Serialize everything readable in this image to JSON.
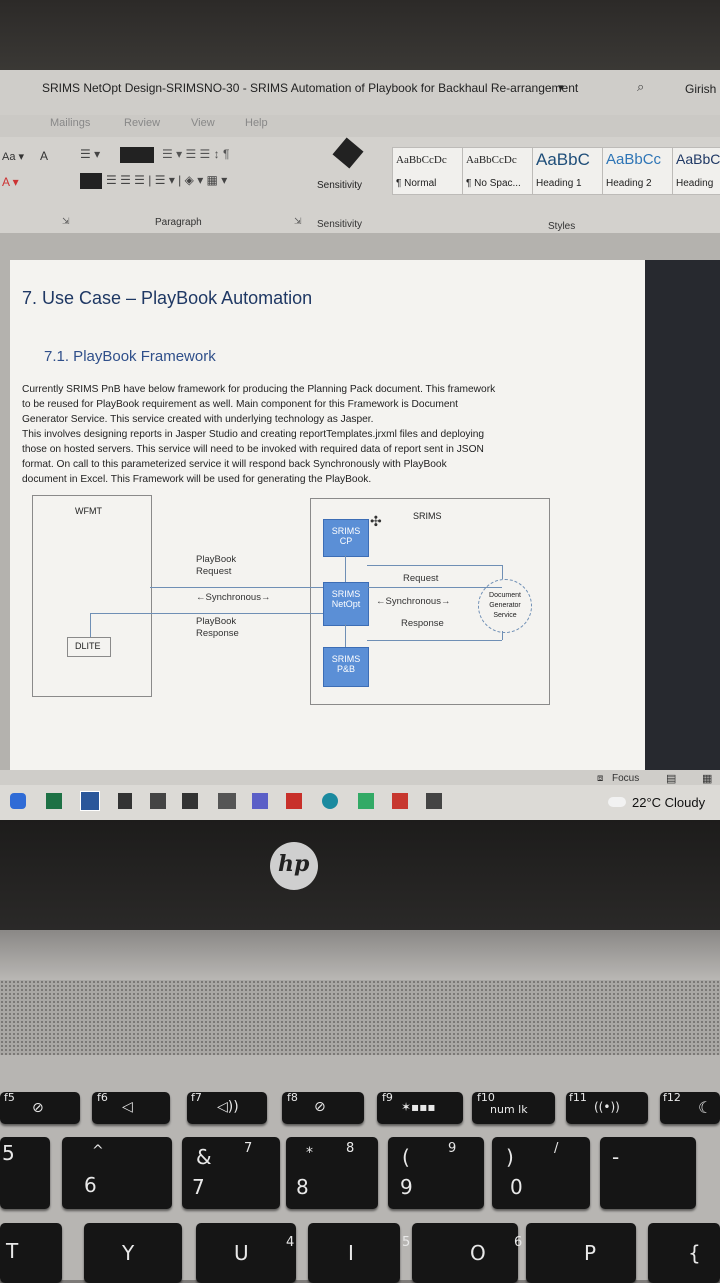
{
  "window": {
    "title": "SRIMS NetOpt Design-SRIMSNO-30 - SRIMS Automation of Playbook for Backhaul Re-arrangement",
    "title_dropdown": "▾",
    "user": "Girish S"
  },
  "menu": [
    "Mailings",
    "Review",
    "View",
    "Help"
  ],
  "ribbon": {
    "paragraph_label": "Paragraph",
    "sensitivity_button": "Sensitivity",
    "sensitivity_label": "Sensitivity",
    "styles_label": "Styles",
    "styles": [
      {
        "sample": "AaBbCcDc",
        "name": "¶ Normal"
      },
      {
        "sample": "AaBbCcDc",
        "name": "¶ No Spac..."
      },
      {
        "sample": "AaBbC",
        "name": "Heading 1"
      },
      {
        "sample": "AaBbCc",
        "name": "Heading 2"
      },
      {
        "sample": "AaBbC",
        "name": "Heading"
      }
    ]
  },
  "document": {
    "heading1": "7. Use Case – PlayBook Automation",
    "heading2": "7.1.  PlayBook Framework",
    "body_lines": [
      "Currently SRIMS PnB have below framework for producing the Planning Pack document. This framework",
      "to be reused for PlayBook requirement as well. Main component for this Framework is Document",
      "Generator Service. This service created with underlying technology as Jasper.",
      "This involves designing reports in Jasper Studio and creating reportTemplates.jrxml files and deploying",
      "those on hosted servers. This service will need to be invoked with required data of report sent in JSON",
      "format. On call to this parameterized service it will respond back Synchronously with PlayBook",
      "document in Excel. This Framework will be used for generating the PlayBook."
    ],
    "diagram": {
      "wfmt": "WFMT",
      "srims": "SRIMS",
      "dlite": "DLITE",
      "cp_line1": "SRIMS",
      "cp_line2": "CP",
      "netopt_line1": "SRIMS",
      "netopt_line2": "NetOpt",
      "pb_line1": "SRIMS",
      "pb_line2": "P&B",
      "playbook_request_1": "PlayBook",
      "playbook_request_2": "Request",
      "synchronous_left": "←Synchronous→",
      "playbook_response_1": "PlayBook",
      "playbook_response_2": "Response",
      "request": "Request",
      "synchronous_right": "←Synchronous→",
      "response": "Response",
      "docgen_1": "Document",
      "docgen_2": "Generator",
      "docgen_3": "Service"
    }
  },
  "status": {
    "focus": "Focus"
  },
  "taskbar": {
    "weather": "22°C  Cloudy"
  },
  "brand": "hp",
  "keys": {
    "f5": "f5",
    "f6": "f6",
    "f7": "f7",
    "f8": "f8",
    "f9": "f9",
    "f10": "f10",
    "f11": "f11",
    "f12": "f12",
    "numlk": "num lk",
    "amp": "&",
    "seven": "7",
    "star": "*",
    "eight": "8",
    "lparen": "(",
    "nine": "9",
    "rparen": ")",
    "zero": "0",
    "six_top": "^",
    "six": "6",
    "k7": "7",
    "k8": "8",
    "k9": "9",
    "slash": "/",
    "minus": "-",
    "T": "T",
    "Y": "Y",
    "U": "U",
    "four": "4",
    "I": "I",
    "five": "5",
    "O": "O",
    "six_b": "6",
    "P": "P",
    "five_left": "5"
  },
  "colors": {
    "diagram_box": "#5b8fd6",
    "heading_blue": "#1f3864"
  }
}
